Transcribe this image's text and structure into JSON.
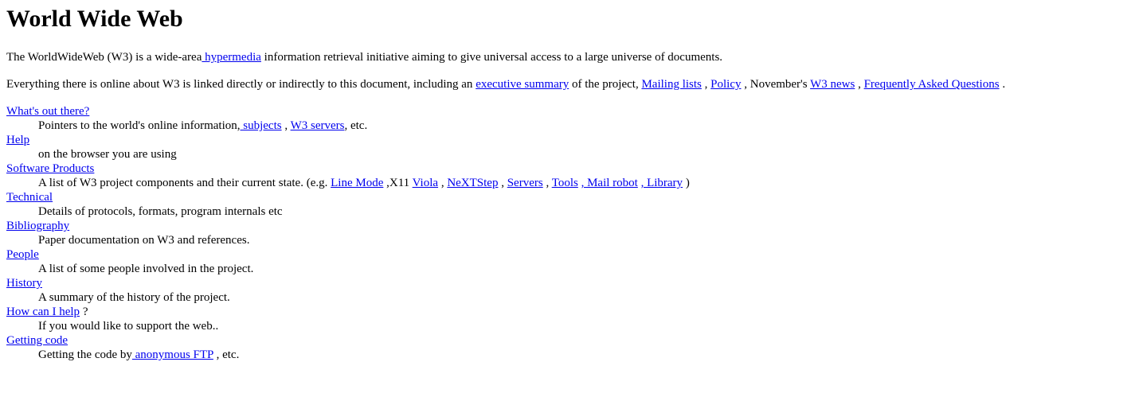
{
  "title": "World Wide Web",
  "intro": {
    "before": "The WorldWideWeb (W3) is a wide-area",
    "link": " hypermedia",
    "after": " information retrieval initiative aiming to give universal access to a large universe of documents."
  },
  "everything": {
    "t1": "Everything there is online about W3 is linked directly or indirectly to this document, including an ",
    "l_exec": "executive summary",
    "t2": " of the project, ",
    "l_mail": "Mailing lists",
    "t3": " , ",
    "l_policy": "Policy",
    "t4": " , November's ",
    "l_news": "W3 news",
    "t5": " , ",
    "l_faq": "Frequently Asked Questions",
    "t6": " ."
  },
  "sections": {
    "whats_out": {
      "title": "What's out there?",
      "d1": "Pointers to the world's online information,",
      "l_subjects": " subjects",
      "d2": " , ",
      "l_servers": "W3 servers",
      "d3": ", etc."
    },
    "help": {
      "title": "Help",
      "desc": "on the browser you are using"
    },
    "software": {
      "title": "Software Products",
      "d1": "A list of W3 project components and their current state. (e.g. ",
      "l_linemode": "Line Mode",
      "d2": " ,X11 ",
      "l_viola": "Viola",
      "d3": " , ",
      "l_nextstep": "NeXTStep",
      "d4": " , ",
      "l_servers": "Servers",
      "d5": " , ",
      "l_tools": "Tools",
      "d6": " ",
      "l_mailrobot": ", Mail robot",
      "d7": " ",
      "l_library": ", Library",
      "d8": " )"
    },
    "technical": {
      "title": "Technical",
      "desc": "Details of protocols, formats, program internals etc"
    },
    "bibliography": {
      "title": "Bibliography",
      "desc": "Paper documentation on W3 and references."
    },
    "people": {
      "title": "People",
      "desc": "A list of some people involved in the project."
    },
    "history": {
      "title": "History",
      "desc": "A summary of the history of the project."
    },
    "howcanihelp": {
      "title": "How can I help",
      "suffix": " ?",
      "desc": "If you would like to support the web.."
    },
    "gettingcode": {
      "title": "Getting code",
      "d1": "Getting the code by",
      "l_ftp": " anonymous FTP",
      "d2": " , etc."
    }
  }
}
